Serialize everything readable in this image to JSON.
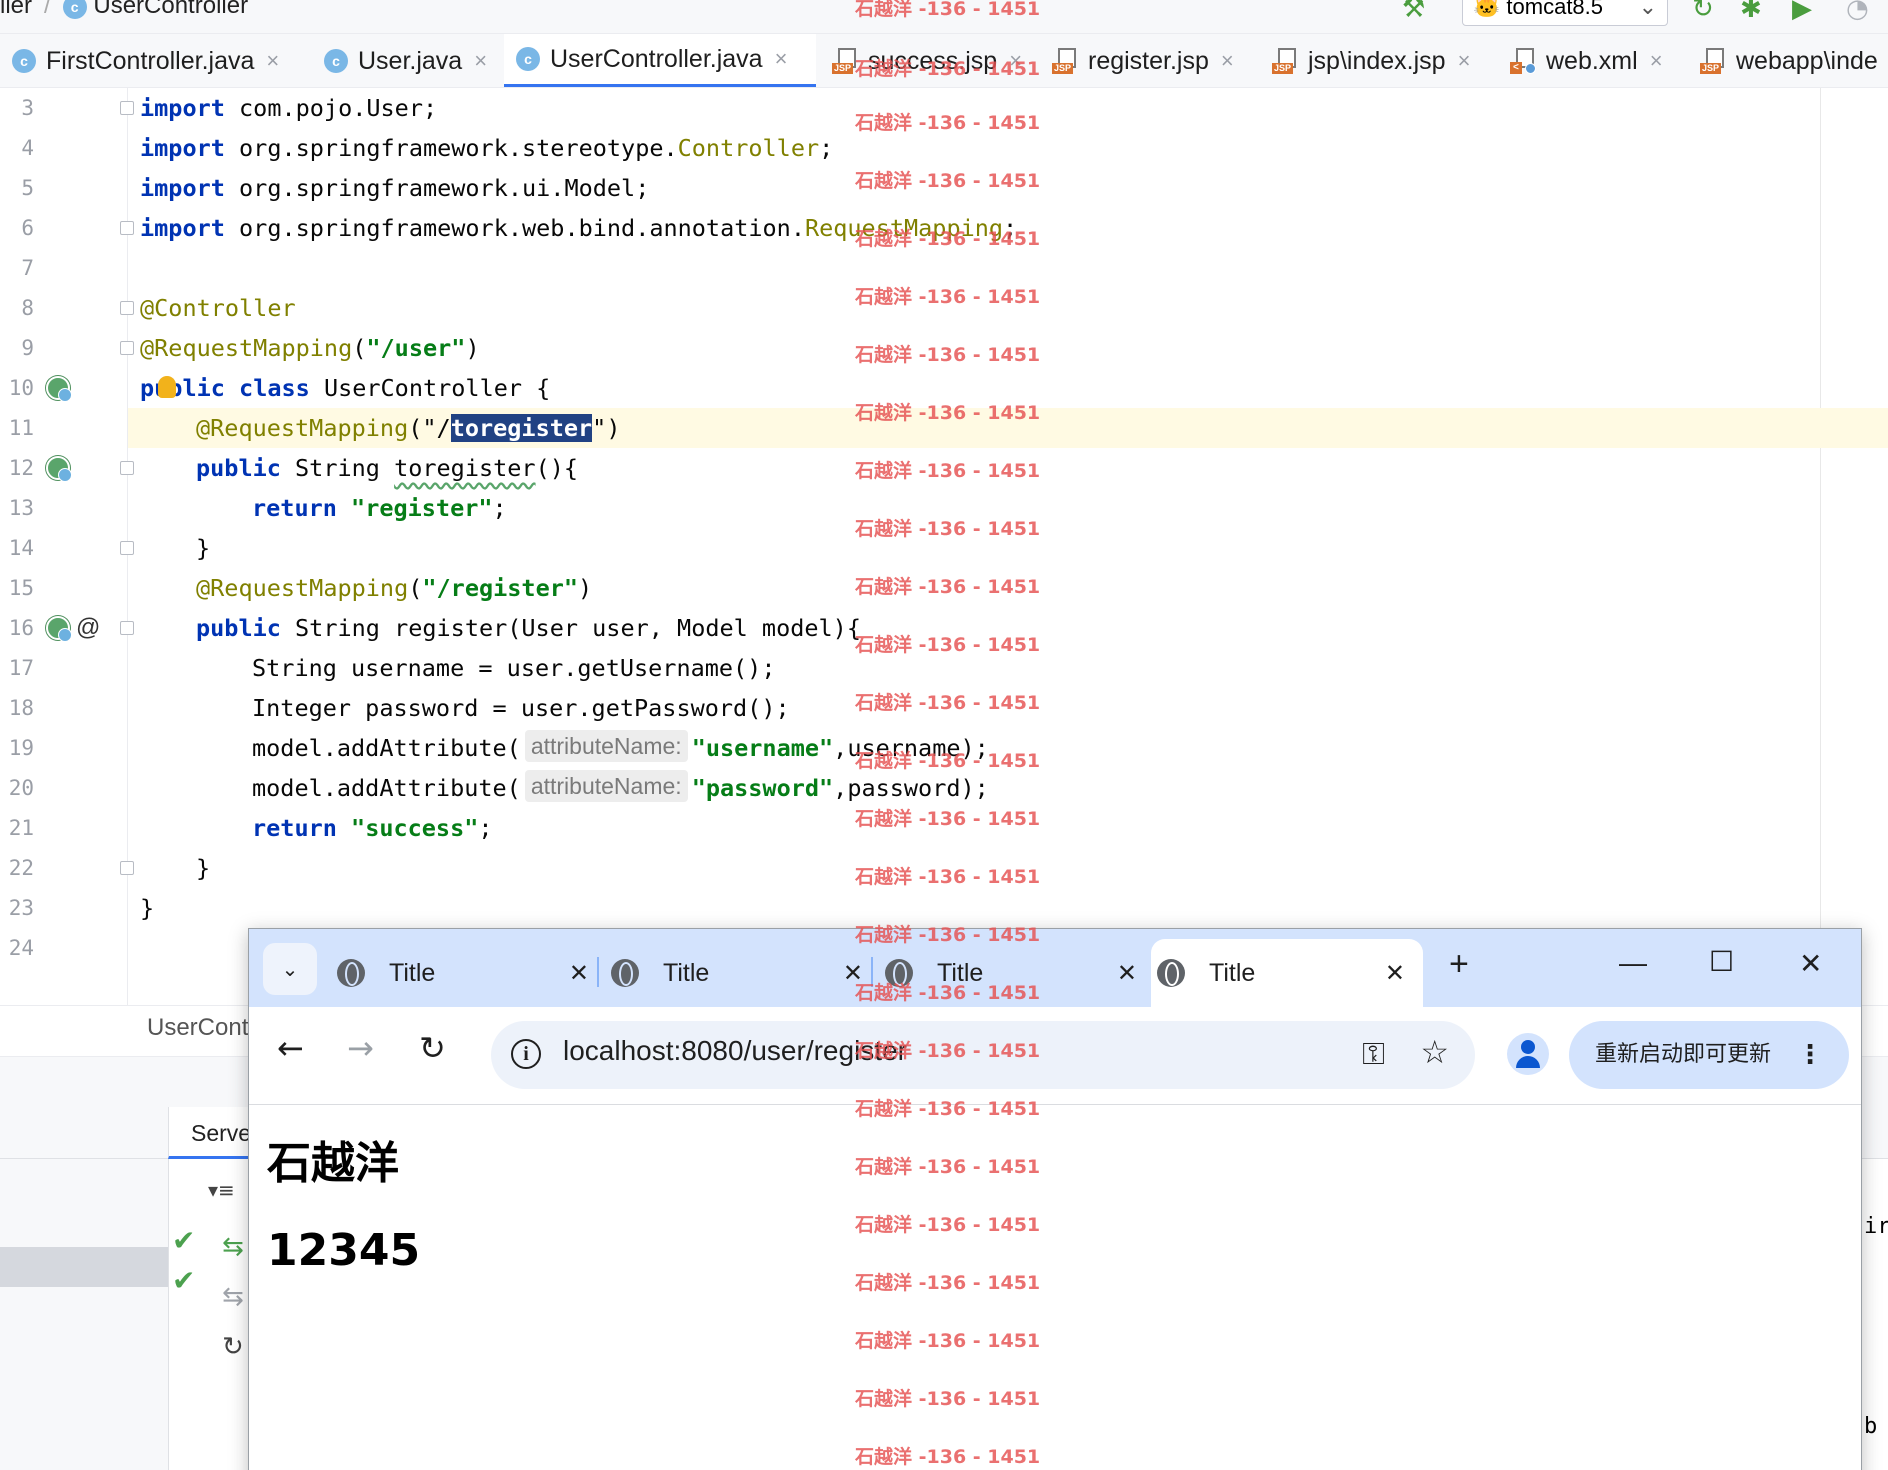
{
  "ide": {
    "breadcrumb": [
      "ller",
      "UserController"
    ],
    "run_config": "tomcat8.5",
    "tabs": [
      {
        "label": "FirstController.java",
        "type": "java"
      },
      {
        "label": "User.java",
        "type": "java"
      },
      {
        "label": "UserController.java",
        "type": "java",
        "active": true
      },
      {
        "label": "success.jsp",
        "type": "jsp"
      },
      {
        "label": "register.jsp",
        "type": "jsp"
      },
      {
        "label": "jsp\\index.jsp",
        "type": "jsp"
      },
      {
        "label": "web.xml",
        "type": "xml"
      },
      {
        "label": "webapp\\inde",
        "type": "jsp"
      }
    ],
    "close_glyph": "×",
    "line_numbers": [
      "3",
      "4",
      "5",
      "6",
      "7",
      "8",
      "9",
      "10",
      "11",
      "12",
      "13",
      "14",
      "15",
      "16",
      "17",
      "18",
      "19",
      "20",
      "21",
      "22",
      "23",
      "24"
    ],
    "hint_label": "attributeName:",
    "code": {
      "l3": {
        "kw": "import",
        "rest": " com.pojo.User;"
      },
      "l4": {
        "kw": "import",
        "rest": " org.springframework.stereotype.",
        "an": "Controller",
        "end": ";"
      },
      "l5": {
        "kw": "import",
        "rest": " org.springframework.ui.Model;"
      },
      "l6": {
        "kw": "import",
        "rest": " org.springframework.web.bind.annotation.",
        "an": "RequestMapping",
        "end": ";"
      },
      "l8": {
        "an": "@Controller"
      },
      "l9": {
        "an": "@RequestMapping",
        "open": "(",
        "st": "\"/user\"",
        "close": ")"
      },
      "l10": {
        "kw1": "public",
        "kw2": "class",
        "rest": " UserController {"
      },
      "l11": {
        "an": "@RequestMapping",
        "open": "(\"/",
        "sel": "toregister",
        "close": "\")"
      },
      "l12": {
        "kw": "public",
        "pre": " String ",
        "name": "toregister",
        "post": "(){"
      },
      "l13": {
        "kw": "return",
        "st": "\"register\"",
        "end": ";"
      },
      "l14": {
        "text": "}"
      },
      "l15": {
        "an": "@RequestMapping",
        "open": "(",
        "st": "\"/register\"",
        "close": ")"
      },
      "l16": {
        "kw": "public",
        "rest": " String register(User user, Model model){"
      },
      "l17": {
        "text": "String username = user.getUsername();"
      },
      "l18": {
        "text": "Integer password = user.getPassword();"
      },
      "l19": {
        "pre": "model.addAttribute(",
        "st": "\"username\"",
        "post": ",username);"
      },
      "l20": {
        "pre": "model.addAttribute(",
        "st": "\"password\"",
        "post": ",password);"
      },
      "l21": {
        "kw": "return",
        "st": "\"success\"",
        "end": ";"
      },
      "l22": {
        "text": "}"
      },
      "l23": {
        "text": "}"
      }
    },
    "bottom_breadcrumb": "UserCont",
    "services_tab": "Serve",
    "edge_text_1": "ir",
    "edge_text_2": "b"
  },
  "browser": {
    "tabs": [
      {
        "title": "Title"
      },
      {
        "title": "Title"
      },
      {
        "title": "Title"
      },
      {
        "title": "Title",
        "active": true
      }
    ],
    "url": "localhost:8080/user/register",
    "update_button": "重新启动即可更新",
    "content": {
      "username": "石越洋",
      "password": "12345"
    }
  },
  "watermark": {
    "text": "石越洋 -136 - 1451",
    "color": "#e55050"
  }
}
